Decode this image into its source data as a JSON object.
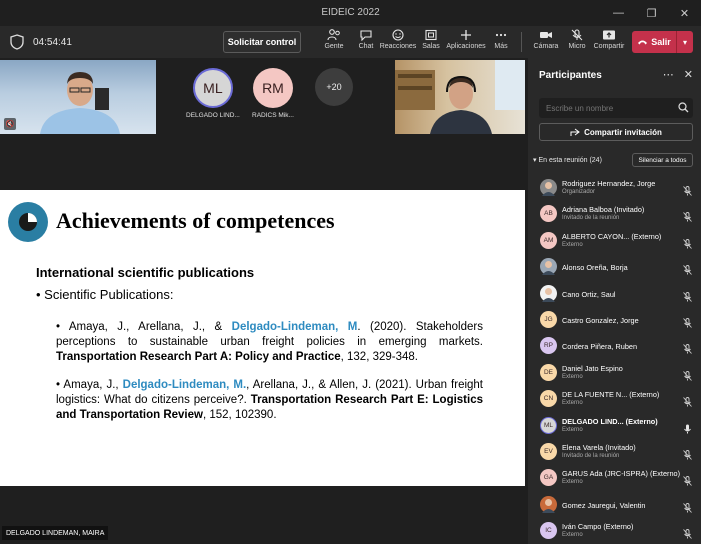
{
  "window": {
    "title": "EIDEIC 2022"
  },
  "toolbar": {
    "timer": "04:54:41",
    "request_control": "Solicitar control",
    "items": [
      {
        "label": "Gente"
      },
      {
        "label": "Chat"
      },
      {
        "label": "Reacciones"
      },
      {
        "label": "Salas"
      },
      {
        "label": "Aplicaciones"
      },
      {
        "label": "Más"
      },
      {
        "label": "Cámara"
      },
      {
        "label": "Micro"
      },
      {
        "label": "Compartir"
      }
    ],
    "leave": "Salir"
  },
  "strip": {
    "tiles": [
      {
        "initials": "ML",
        "name": "DELGADO LIND...",
        "color": "#d6d6d6"
      },
      {
        "initials": "RM",
        "name": "RADICS Mik...",
        "color": "#f4c7c3"
      }
    ],
    "more": "+20"
  },
  "slide": {
    "title": "Achievements of competences",
    "heading": "International scientific publications",
    "bullet": "• Scientific Publications:",
    "ref1": {
      "a": "• Amaya, J., Arellana, J., & ",
      "hl": "Delgado-Lindeman, M",
      "b": ". (2020). Stakeholders perceptions to sustainable urban freight policies in emerging markets. ",
      "journal": "Transportation Research Part A: Policy and Practice",
      "c": ", 132, 329-348."
    },
    "ref2": {
      "a": "• Amaya, J., ",
      "hl": "Delgado-Lindeman, M.",
      "b": ", Arellana, J., & Allen, J. (2021). Urban freight logistics: What do citizens perceive?. ",
      "journal": "Transportation Research Part E: Logistics and Transportation Review",
      "c": ", 152, 102390."
    },
    "presenter": "DELGADO LINDEMAN, MAIRA"
  },
  "panel": {
    "title": "Participantes",
    "search_placeholder": "Escribe un nombre",
    "share_invite": "Compartir invitación",
    "section": "En esta reunión (24)",
    "mute_all": "Silenciar a todos",
    "participants": [
      {
        "name": "Rodriguez Hernandez, Jorge",
        "role": "Organizador",
        "initials": "",
        "color": "#8a8a8a",
        "photo": true
      },
      {
        "name": "Adriana Balboa (Invitado)",
        "role": "Invitado de la reunión",
        "initials": "AB",
        "color": "#f4c7c3"
      },
      {
        "name": "ALBERTO CAYON... (Externo)",
        "role": "Externo",
        "initials": "AM",
        "color": "#f4c7c3"
      },
      {
        "name": "Alonso Oreña, Borja",
        "role": "",
        "initials": "",
        "color": "#9aa7b5",
        "photo": true
      },
      {
        "name": "Cano Ortiz, Saul",
        "role": "",
        "initials": "",
        "color": "#f2f2f2",
        "photo": true
      },
      {
        "name": "Castro Gonzalez, Jorge",
        "role": "",
        "initials": "JG",
        "color": "#f9d8a8"
      },
      {
        "name": "Cordera Piñera, Ruben",
        "role": "",
        "initials": "RP",
        "color": "#d9c6f0"
      },
      {
        "name": "Daniel Jato Espino",
        "role": "Externo",
        "initials": "DE",
        "color": "#f9d8a8"
      },
      {
        "name": "DE LA FUENTE N... (Externo)",
        "role": "Externo",
        "initials": "CN",
        "color": "#f9d8a8"
      },
      {
        "name": "DELGADO LIND... (Externo)",
        "role": "Externo",
        "initials": "ML",
        "color": "#d6d6d6",
        "active": true
      },
      {
        "name": "Elena Varela (Invitado)",
        "role": "Invitado de la reunión",
        "initials": "EV",
        "color": "#f9d8a8"
      },
      {
        "name": "GARUS Ada (JRC-ISPRA) (Externo)",
        "role": "Externo",
        "initials": "GA",
        "color": "#f4c7c3"
      },
      {
        "name": "Gomez Jauregui, Valentin",
        "role": "",
        "initials": "",
        "color": "#c86a3a",
        "photo": true
      },
      {
        "name": "Iván Campo (Externo)",
        "role": "Externo",
        "initials": "IC",
        "color": "#d9c6f0"
      }
    ]
  },
  "colors": {
    "accent": "#2e8bc0",
    "leave": "#c4314b",
    "panel": "#292929"
  }
}
